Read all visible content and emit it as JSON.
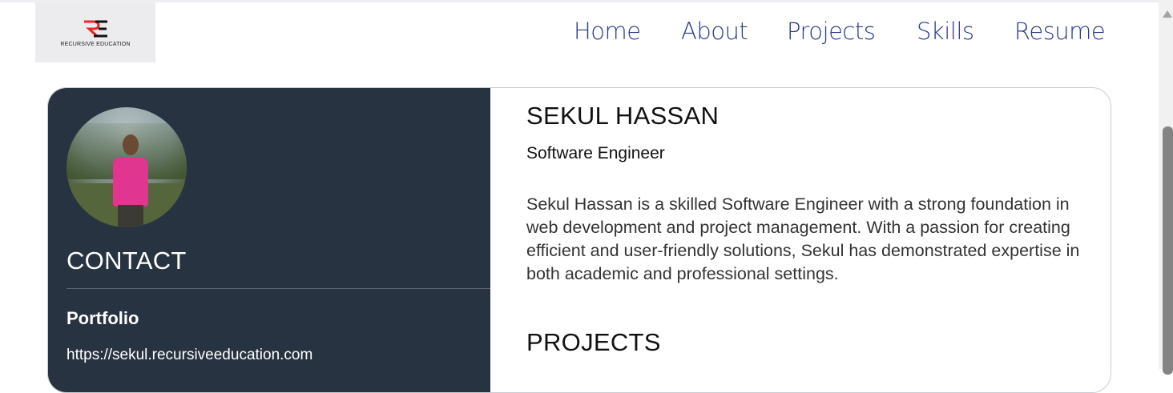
{
  "header": {
    "logo_text": "RECURSIVE EDUCATION",
    "nav": [
      {
        "label": "Home"
      },
      {
        "label": "About"
      },
      {
        "label": "Projects"
      },
      {
        "label": "Skills"
      },
      {
        "label": "Resume"
      }
    ]
  },
  "sidebar": {
    "contact_title": "CONTACT",
    "portfolio_label": "Portfolio",
    "portfolio_url": "https://sekul.recursiveeducation.com"
  },
  "profile": {
    "name": "SEKUL HASSAN",
    "role": "Software Engineer",
    "bio": "Sekul Hassan is a skilled Software Engineer with a strong foundation in web development and project management. With a passion for creating efficient and user-friendly solutions, Sekul has demonstrated expertise in both academic and professional settings.",
    "projects_heading": "PROJECTS"
  },
  "colors": {
    "nav_link": "#2b3a8a",
    "sidebar_bg": "#283341",
    "logo_red": "#e8262b"
  },
  "icons": {
    "logo": "recursive-education-logo",
    "scroll_up": "triangle-up"
  }
}
